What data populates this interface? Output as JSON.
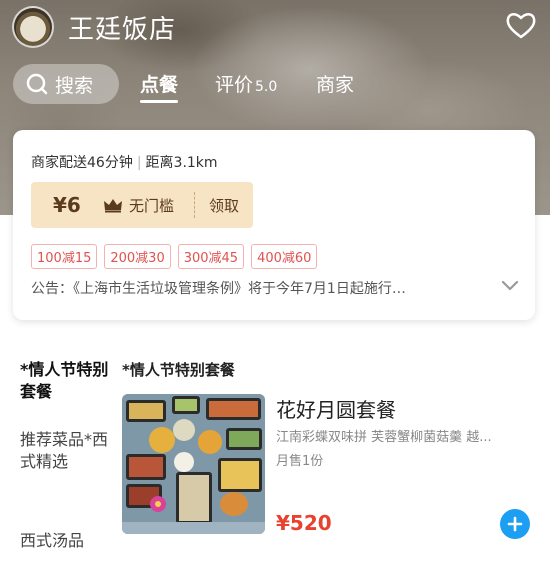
{
  "shop": {
    "name": "王廷饭店"
  },
  "nav": {
    "search_label": "搜索",
    "tabs": [
      {
        "label": "点餐",
        "active": true
      },
      {
        "label": "评价",
        "rating": "5.0"
      },
      {
        "label": "商家"
      }
    ]
  },
  "info": {
    "delivery": "商家配送46分钟",
    "distance": "距离3.1km",
    "coupon": {
      "amount": "¥6",
      "condition": "无门槛",
      "action": "领取"
    },
    "promotions": [
      "100减15",
      "200减30",
      "300减45",
      "400减60"
    ],
    "notice": "公告：《上海市生活垃圾管理条例》将于今年7月1日起施行…"
  },
  "menu": {
    "categories": [
      {
        "label": "*情人节特别套餐",
        "active": true
      },
      {
        "label": "推荐菜品*西式精选"
      },
      {
        "label": "西式汤品"
      }
    ],
    "section_title": "*情人节特别套餐",
    "items": [
      {
        "name": "花好月圆套餐",
        "description": "江南彩蝶双味拼 芙蓉蟹柳菌菇羹 越...",
        "sales": "月售1份",
        "price": "¥520"
      }
    ]
  },
  "colors": {
    "accent_blue": "#1c9ff2",
    "price_red": "#e8412f",
    "coupon_bg": "#f7e4c4",
    "promo_red": "#e0524f"
  }
}
